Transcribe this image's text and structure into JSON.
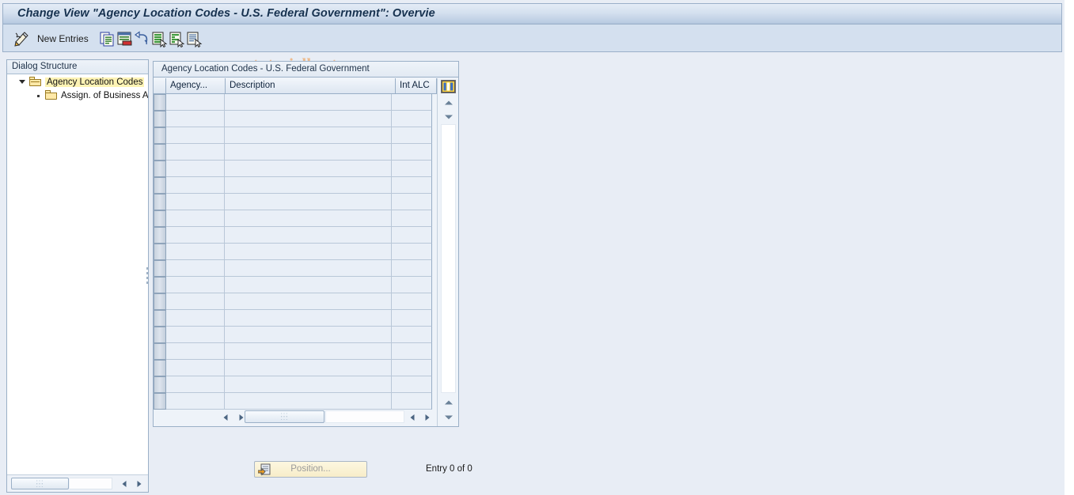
{
  "window": {
    "title": "Change View \"Agency Location Codes - U.S. Federal Government\": Overvie"
  },
  "toolbar": {
    "new_entries_label": "New Entries",
    "icons": [
      {
        "name": "display-change-icon",
        "title": "Display/Change"
      },
      {
        "name": "copy-as-icon",
        "title": "Copy As..."
      },
      {
        "name": "delete-icon",
        "title": "Delete"
      },
      {
        "name": "undo-icon",
        "title": "Undo Change"
      },
      {
        "name": "select-all-icon",
        "title": "Select All"
      },
      {
        "name": "deselect-all-icon",
        "title": "Deselect All"
      },
      {
        "name": "details-icon",
        "title": "Details"
      }
    ],
    "watermark": "www.tutorialkart.com"
  },
  "sidebar": {
    "header": "Dialog Structure",
    "items": [
      {
        "label": "Agency Location Codes",
        "level": 1,
        "selected": true,
        "expanded": true
      },
      {
        "label": "Assign. of Business A",
        "level": 2,
        "selected": false,
        "expanded": false
      }
    ],
    "hscroll": {
      "dots": "⋮⋮⋮"
    }
  },
  "table": {
    "caption": "Agency Location Codes - U.S. Federal Government",
    "columns": [
      {
        "key": "select",
        "label": ""
      },
      {
        "key": "agency",
        "label": "Agency..."
      },
      {
        "key": "description",
        "label": "Description"
      },
      {
        "key": "int_alc",
        "label": "Int ALC"
      }
    ],
    "rows": [],
    "visible_row_count": 19,
    "grid_config_icon": "table-settings-icon"
  },
  "footer": {
    "position_button_label": "Position...",
    "entry_count": "Entry 0 of 0"
  },
  "colors": {
    "title_bar_text": "#16314f",
    "watermark": "#edbb8e",
    "panel_border": "#9bb0c7",
    "row_background": "#e9eff7",
    "tree_selection": "#fdf3b4",
    "button_yellow": "#f7edc9"
  }
}
